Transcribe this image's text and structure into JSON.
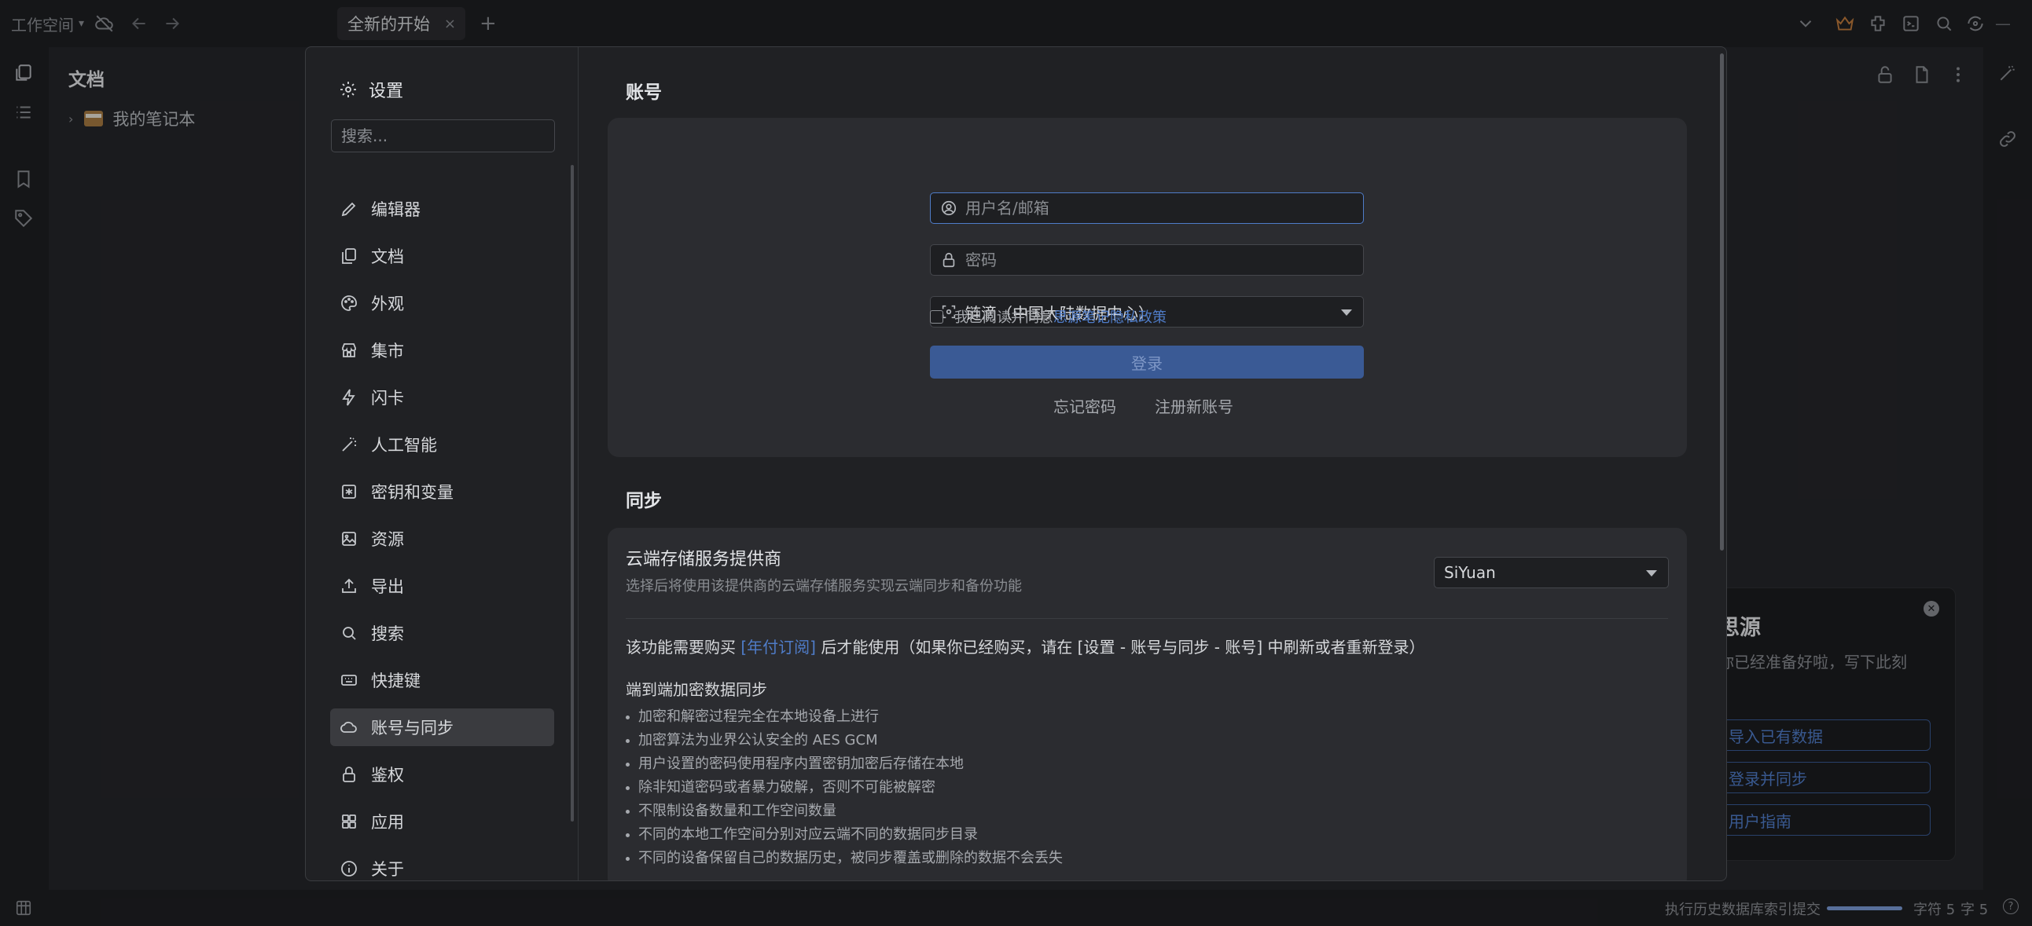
{
  "topbar": {
    "workspace_label": "工作空间",
    "tab_title": "全新的开始",
    "tab_close": "×",
    "new_tab": "+"
  },
  "tree": {
    "title": "文档",
    "notebook": "我的笔记本"
  },
  "welcome": {
    "title": "思源",
    "desc": "你已经准备好啦，写下此刻",
    "btn_import": "导入已有数据",
    "btn_login_sync": "登录并同步",
    "btn_guide": "用户指南"
  },
  "settings": {
    "title": "设置",
    "search_placeholder": "搜索...",
    "nav": [
      {
        "label": "编辑器",
        "icon": "pencil-icon"
      },
      {
        "label": "文档",
        "icon": "documents-icon"
      },
      {
        "label": "外观",
        "icon": "palette-icon"
      },
      {
        "label": "集市",
        "icon": "store-icon"
      },
      {
        "label": "闪卡",
        "icon": "lightning-icon"
      },
      {
        "label": "人工智能",
        "icon": "magic-wand-icon"
      },
      {
        "label": "密钥和变量",
        "icon": "key-star-icon"
      },
      {
        "label": "资源",
        "icon": "image-icon"
      },
      {
        "label": "导出",
        "icon": "upload-icon"
      },
      {
        "label": "搜索",
        "icon": "search-icon"
      },
      {
        "label": "快捷键",
        "icon": "keyboard-icon"
      },
      {
        "label": "账号与同步",
        "icon": "cloud-icon"
      },
      {
        "label": "鉴权",
        "icon": "lock-icon"
      },
      {
        "label": "应用",
        "icon": "grid-icon"
      },
      {
        "label": "关于",
        "icon": "info-icon"
      }
    ],
    "active_nav": "账号与同步"
  },
  "account": {
    "section_title": "账号",
    "username_placeholder": "用户名/邮箱",
    "password_placeholder": "密码",
    "region": "链滴（中国大陆数据中心）",
    "agree_prefix": "我已阅读并同意",
    "agree_link": "思源笔记隐私政策",
    "login_button": "登录",
    "forgot_password": "忘记密码",
    "register": "注册新账号"
  },
  "sync": {
    "section_title": "同步",
    "provider_title": "云端存储服务提供商",
    "provider_desc": "选择后将使用该提供商的云端存储服务实现云端同步和备份功能",
    "provider_value": "SiYuan",
    "notice_prefix": "该功能需要购买",
    "notice_link": "[年付订阅]",
    "notice_suffix": "后才能使用（如果你已经购买，请在 [设置 - 账号与同步 - 账号] 中刷新或者重新登录）",
    "features_title": "端到端加密数据同步",
    "features": [
      "加密和解密过程完全在本地设备上进行",
      "加密算法为业界公认安全的 AES GCM",
      "用户设置的密码使用程序内置密钥加密后存储在本地",
      "除非知道密码或者暴力破解，否则不可能被解密",
      "不限制设备数量和工作空间数量",
      "不同的本地工作空间分别对应云端不同的数据同步目录",
      "不同的设备保留自己的数据历史，被同步覆盖或删除的数据不会丢失"
    ]
  },
  "status": {
    "task": "执行历史数据库索引提交",
    "progress": 1.0,
    "chars": "字符 5",
    "words": "字 5",
    "help": "?"
  }
}
